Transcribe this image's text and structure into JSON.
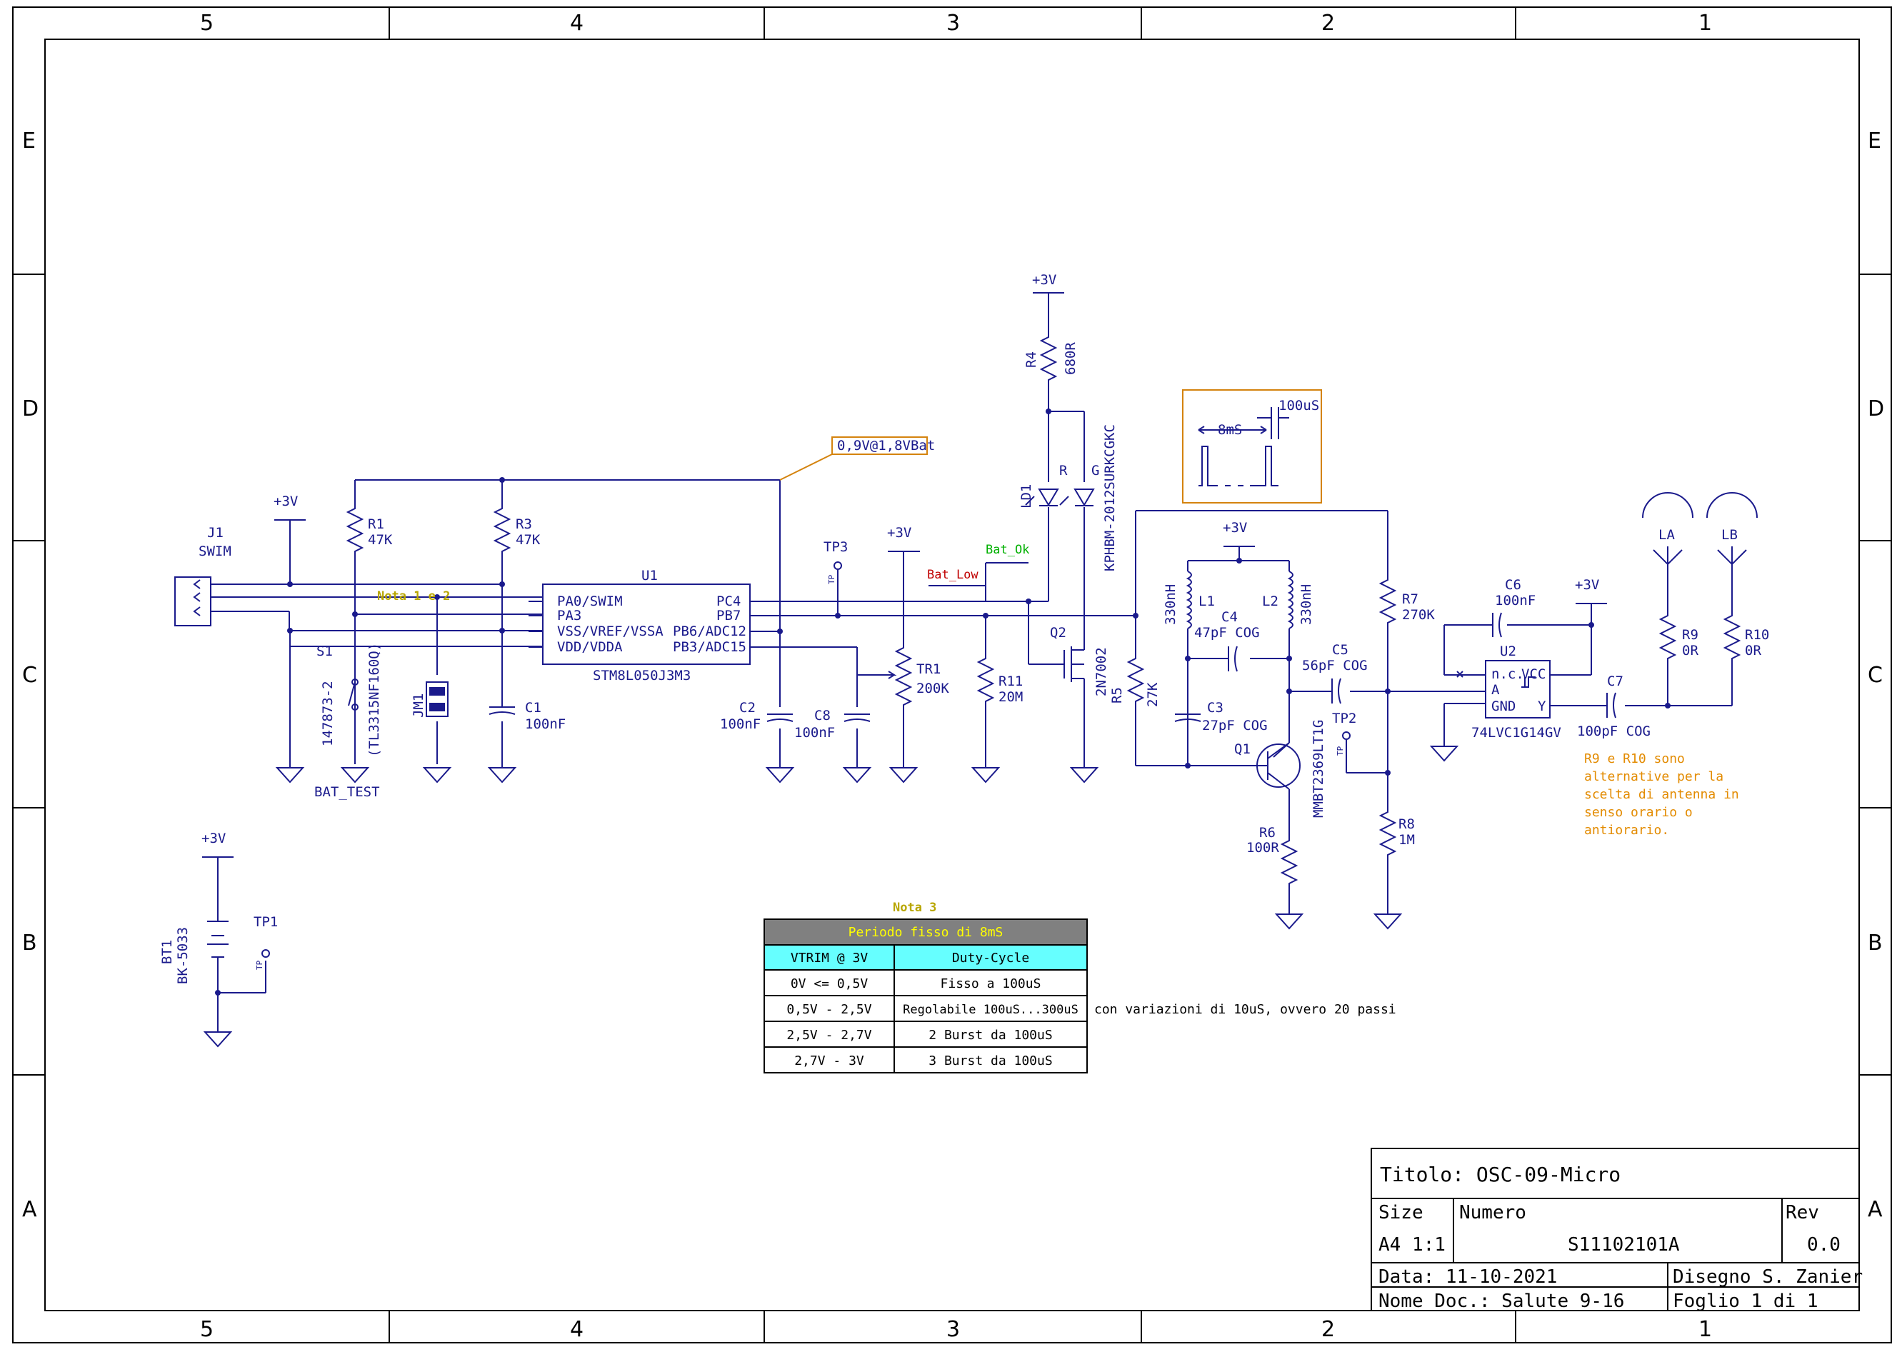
{
  "frame": {
    "columns": [
      "5",
      "4",
      "3",
      "2",
      "1"
    ],
    "rows": [
      "E",
      "D",
      "C",
      "B",
      "A"
    ]
  },
  "components": {
    "j1_ref": "J1",
    "j1_val": "SWIM",
    "u1_ref": "U1",
    "u1_val": "STM8L050J3M3",
    "u1_pins_left": [
      "PA0/SWIM",
      "PA3",
      "VSS/VREF/VSSA",
      "VDD/VDDA"
    ],
    "u1_pins_right": [
      "PC4",
      "PB7",
      "PB6/ADC12",
      "PB3/ADC15"
    ],
    "r1_ref": "R1",
    "r1_val": "47K",
    "r3_ref": "R3",
    "r3_val": "47K",
    "r4_ref": "R4",
    "r4_val": "680R",
    "r5_ref": "R5",
    "r5_val": "27K",
    "r6_ref": "R6",
    "r6_val": "100R",
    "r7_ref": "R7",
    "r7_val": "270K",
    "r8_ref": "R8",
    "r8_val": "1M",
    "r9_ref": "R9",
    "r9_val": "0R",
    "r10_ref": "R10",
    "r10_val": "0R",
    "r11_ref": "R11",
    "r11_val": "20M",
    "c1_ref": "C1",
    "c1_val": "100nF",
    "c2_ref": "C2",
    "c2_val": "100nF",
    "c3_ref": "C3",
    "c3_val": "27pF  COG",
    "c4_ref": "C4",
    "c4_val": "47pF  COG",
    "c5_ref": "C5",
    "c5_val": "56pF  COG",
    "c6_ref": "C6",
    "c6_val": "100nF",
    "c7_ref": "C7",
    "c7_val": "100pF  COG",
    "c8_ref": "C8",
    "c8_val": "100nF",
    "l1_ref": "L1",
    "l1_val": "330nH",
    "l2_ref": "L2",
    "l2_val": "330nH",
    "q1_ref": "Q1",
    "q1_val": "MMBT2369LT1G",
    "q2_ref": "Q2",
    "q2_val": "2N7002",
    "ld1_ref": "LD1",
    "ld1_val": "KPHBM-2012SURKCGKC",
    "ld1_r": "R",
    "ld1_g": "G",
    "u2_ref": "U2",
    "u2_val": "74LVC1G14GV",
    "u2_pins": [
      "n.c.",
      "VCC",
      "A",
      "GND",
      "Y"
    ],
    "tr1_ref": "TR1",
    "tr1_val": "200K",
    "s1_ref": "S1",
    "s1_val": "147873-2",
    "s1_alt": "(TL3315NF160Q)",
    "s1_net": "BAT_TEST",
    "jm1_ref": "JM1",
    "bt1_ref": "BT1",
    "bt1_val": "BK-5033",
    "tp1": "TP1",
    "tp2": "TP2",
    "tp3": "TP3",
    "tp_pin": "TP",
    "la": "LA",
    "lb": "LB",
    "vcc": "+3V"
  },
  "labels": {
    "note12": "Nota 1 e 2",
    "note3": "Nota 3",
    "bat_ok": "Bat_Ok",
    "bat_low": "Bat_Low",
    "threshold": "0,9V@1,8VBat",
    "wave_period": "8mS",
    "wave_pulse": "100uS",
    "antenna_note": [
      "R9 e R10 sono",
      "alternative per la",
      "scelta di antenna in",
      "senso orario o",
      "antiorario."
    ]
  },
  "table": {
    "title": "Periodo fisso di 8mS",
    "headers": [
      "VTRIM @ 3V",
      "Duty-Cycle"
    ],
    "rows": [
      [
        "0V <= 0,5V",
        "Fisso a 100uS"
      ],
      [
        "0,5V - 2,5V",
        "Regolabile 100uS...300uS"
      ],
      [
        "2,5V - 2,7V",
        "2 Burst da 100uS"
      ],
      [
        "2,7V - 3V",
        "3 Burst da 100uS"
      ]
    ],
    "side_note": "con variazioni di 10uS, ovvero 20 passi"
  },
  "titleblock": {
    "title": "Titolo:  OSC-09-Micro",
    "size_label": "Size",
    "size_value": "A4  1:1",
    "number_label": "Numero",
    "number_value": "S11102101A",
    "rev_label": "Rev",
    "rev_value": "0.0",
    "date": "Data:  11-10-2021",
    "drawn": "Disegno  S.  Zanier",
    "docname": "Nome  Doc.:  Salute  9-16",
    "sheet": "Foglio  1  di  1"
  },
  "colors": {
    "wire": "#1a1a8c",
    "note": "#d4830e",
    "note_text": "#e38b00",
    "bat_ok": "#00b000",
    "bat_low": "#c00000",
    "table_title_bg": "#808080",
    "table_title_fg": "#ffff00",
    "table_header_bg": "#66ffff",
    "note_yellow": "#b8a600"
  }
}
